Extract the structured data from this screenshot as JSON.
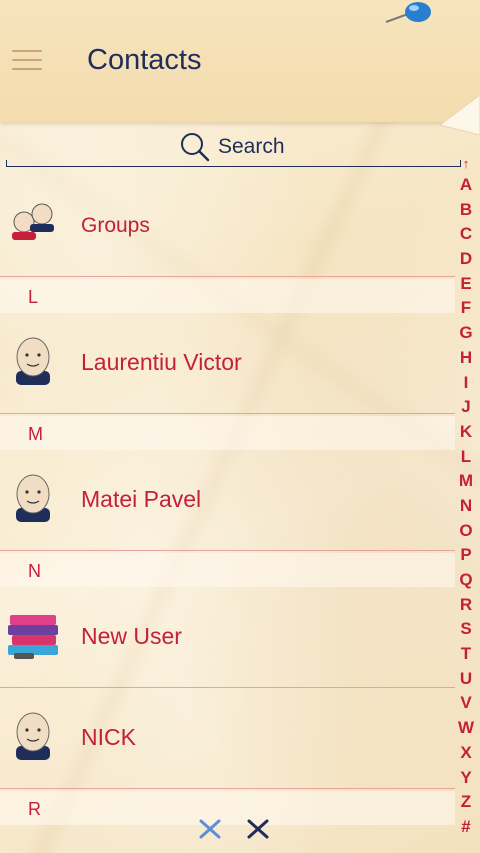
{
  "header": {
    "title": "Contacts"
  },
  "search": {
    "label": "Search"
  },
  "groups": {
    "label": "Groups"
  },
  "contacts": [
    {
      "section": "L",
      "name": "Laurentiu Victor",
      "avatar": "face-avatar"
    },
    {
      "section": "M",
      "name": "Matei Pavel",
      "avatar": "face-avatar"
    },
    {
      "section": "N",
      "name": "New User",
      "avatar": "photo-avatar"
    },
    {
      "section": "",
      "name": "NICK",
      "avatar": "face-avatar"
    }
  ],
  "next_section": "R",
  "index": [
    "↑",
    "A",
    "B",
    "C",
    "D",
    "E",
    "F",
    "G",
    "H",
    "I",
    "J",
    "K",
    "L",
    "M",
    "N",
    "O",
    "P",
    "Q",
    "R",
    "S",
    "T",
    "U",
    "V",
    "W",
    "X",
    "Y",
    "Z",
    "#"
  ],
  "colors": {
    "accent_red": "#c4203a",
    "navy": "#1f2d5a",
    "paper": "#f7e6c6",
    "divider": "#e6a3a0"
  }
}
